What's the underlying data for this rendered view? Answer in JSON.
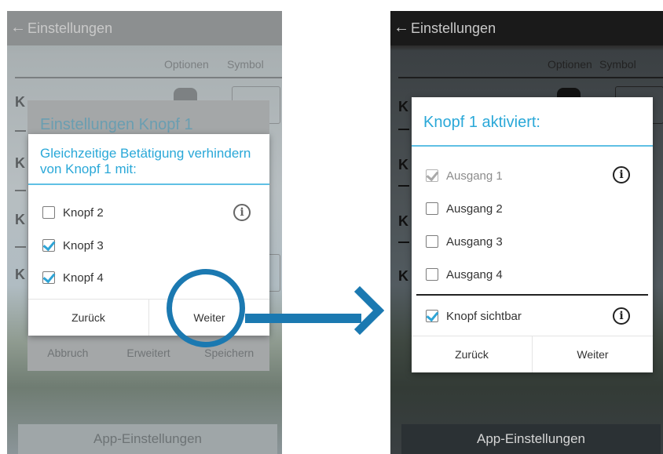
{
  "left_screen": {
    "back_icon": "arrow-left",
    "title": "Einstellungen",
    "columns": [
      "Optionen",
      "Symbol"
    ],
    "row_letters": [
      "K",
      "K",
      "K",
      "K"
    ],
    "underlying_dialog": {
      "title": "Einstellungen Knopf 1",
      "buttons": [
        "Abbruch",
        "Erweitert",
        "Speichern"
      ]
    },
    "dialog": {
      "title": "Gleichzeitige Betätigung verhindern von Knopf 1 mit:",
      "items": [
        {
          "label": "Knopf 2",
          "checked": false
        },
        {
          "label": "Knopf 3",
          "checked": true
        },
        {
          "label": "Knopf 4",
          "checked": true
        }
      ],
      "info_icon": "i",
      "back_label": "Zurück",
      "next_label": "Weiter"
    },
    "footer": "App-Einstellungen"
  },
  "right_screen": {
    "back_icon": "arrow-left",
    "title": "Einstellungen",
    "columns": [
      "Optionen",
      "Symbol"
    ],
    "row_letters": [
      "K",
      "K",
      "K",
      "K"
    ],
    "dialog": {
      "title": "Knopf 1 aktiviert:",
      "items": [
        {
          "label": "Ausgang 1",
          "checked": true,
          "disabled": true
        },
        {
          "label": "Ausgang 2",
          "checked": false
        },
        {
          "label": "Ausgang 3",
          "checked": false
        },
        {
          "label": "Ausgang 4",
          "checked": false
        }
      ],
      "visible_item": {
        "label": "Knopf sichtbar",
        "checked": true
      },
      "info_icon": "i",
      "back_label": "Zurück",
      "next_label": "Weiter"
    },
    "footer": "App-Einstellungen"
  },
  "colors": {
    "accent": "#2aa8d8",
    "annotation": "#1b79b1"
  }
}
